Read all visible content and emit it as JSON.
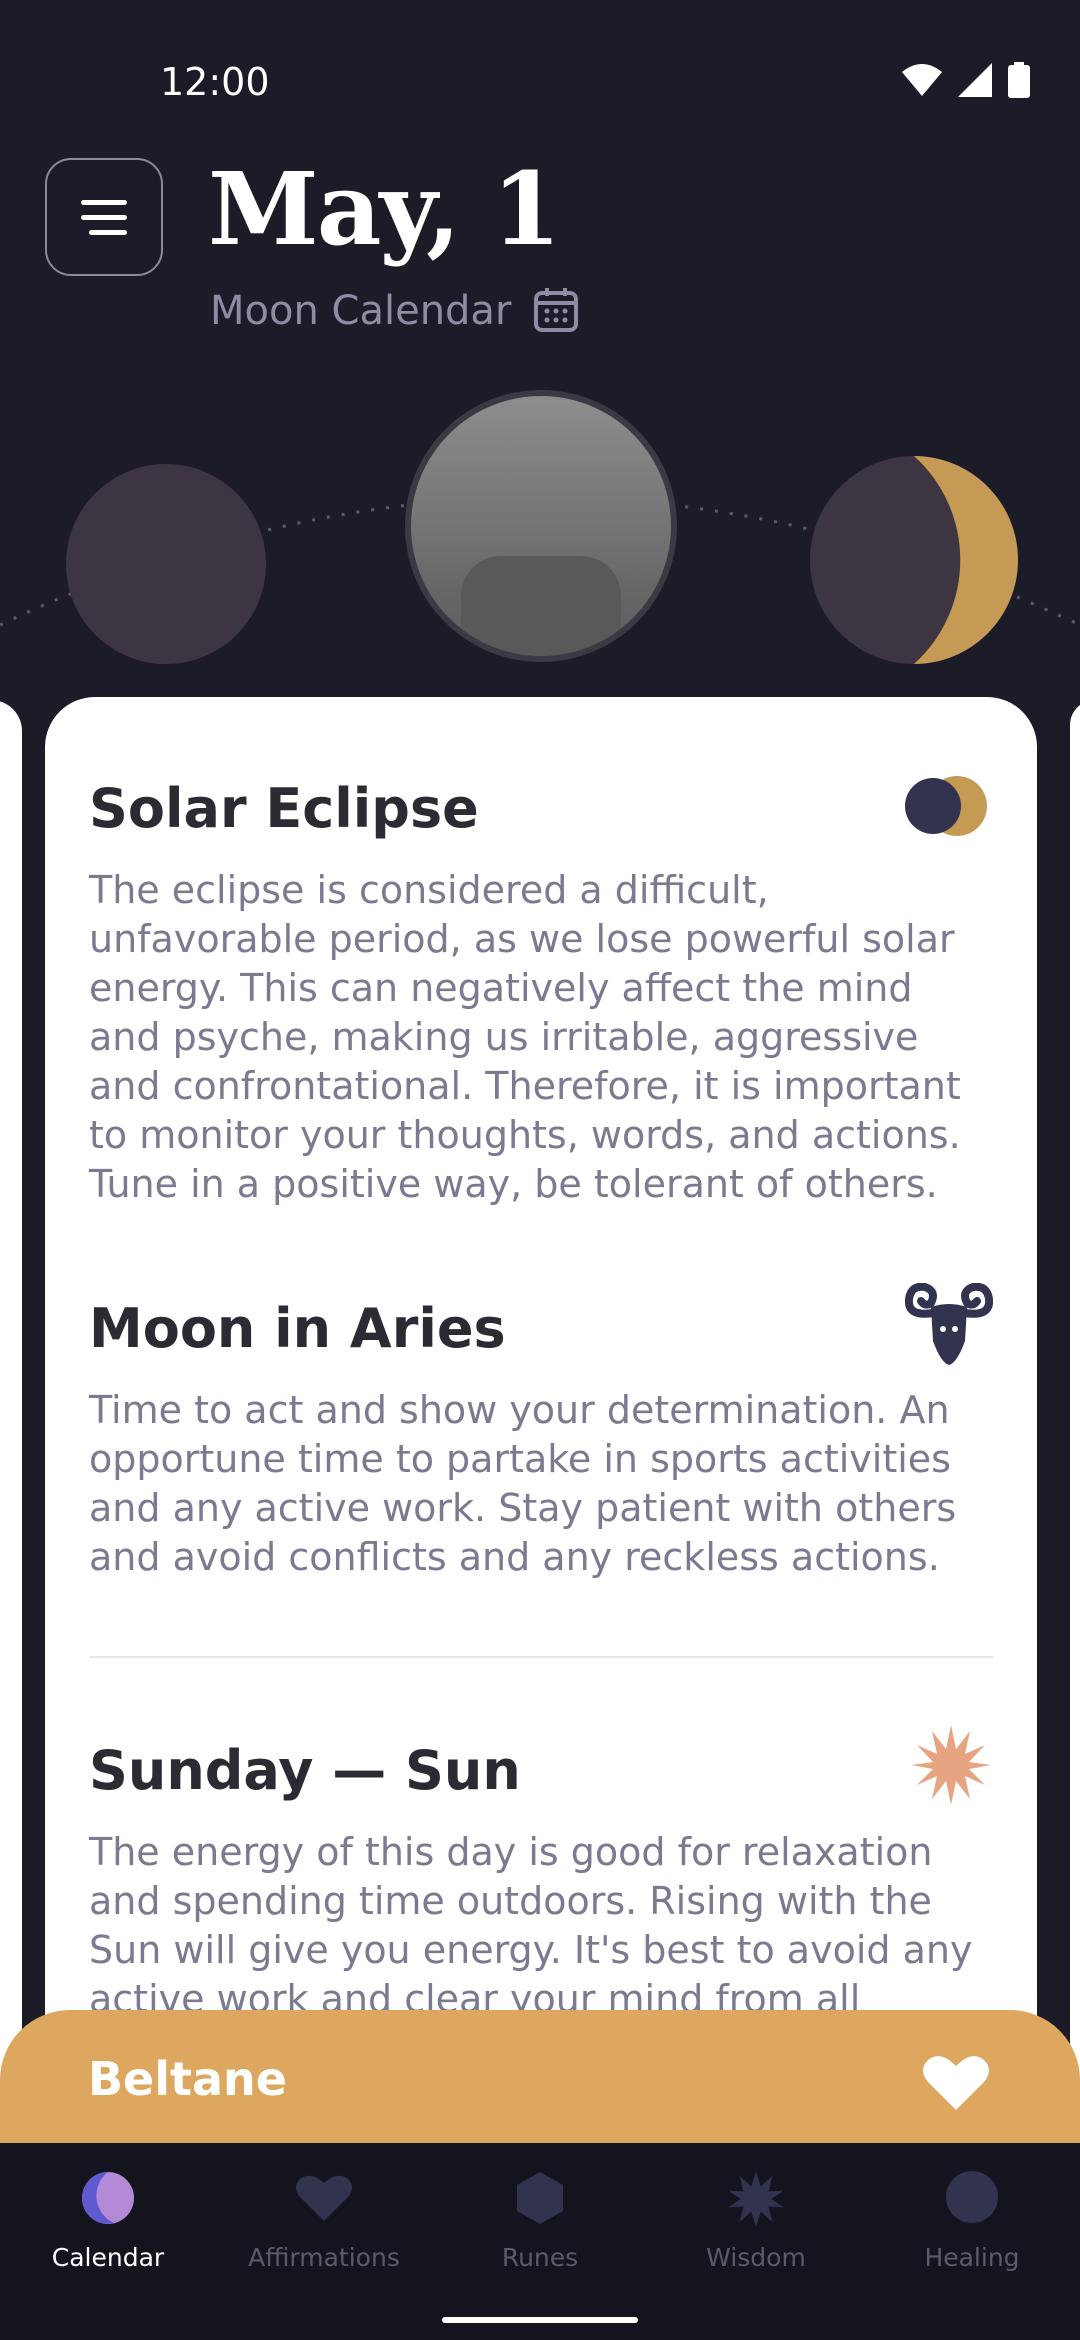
{
  "status_bar": {
    "time": "12:00"
  },
  "header": {
    "date": "May, 1",
    "subtitle": "Moon Calendar"
  },
  "sections": [
    {
      "title": "Solar Eclipse",
      "icon": "eclipse-icon",
      "text": "The eclipse is considered a difficult, unfavorable period, as we lose powerful solar energy. This can negatively affect the mind and psyche, making us irritable, aggressive and confrontational. Therefore, it is important to monitor your thoughts, words, and actions. Tune in a positive way, be tolerant of others."
    },
    {
      "title": "Moon in Aries",
      "icon": "aries-icon",
      "text": "Time to act and show your determination. An opportune time to partake in sports activities and any active work. Stay patient with others and avoid conflicts and any reckless actions."
    },
    {
      "title": "Sunday — Sun",
      "icon": "sun-icon",
      "text": "The energy of this day is good for relaxation and spending time outdoors. Rising with the Sun will give you energy. It's best to avoid any active work and clear your mind from all"
    }
  ],
  "holiday": {
    "title": "Beltane",
    "icon": "heart-icon"
  },
  "nav": {
    "items": [
      {
        "label": "Calendar",
        "icon": "moon-icon",
        "active": true
      },
      {
        "label": "Affirmations",
        "icon": "heart-icon",
        "active": false
      },
      {
        "label": "Runes",
        "icon": "hexagon-icon",
        "active": false
      },
      {
        "label": "Wisdom",
        "icon": "star-icon",
        "active": false
      },
      {
        "label": "Healing",
        "icon": "circle-icon",
        "active": false
      }
    ]
  },
  "colors": {
    "background": "#1c1c29",
    "card": "#ffffff",
    "accent_gold": "#dda760",
    "moon_crescent": "#c49a55",
    "sun_icon": "#e7a483",
    "icon_dark": "#32334f"
  }
}
